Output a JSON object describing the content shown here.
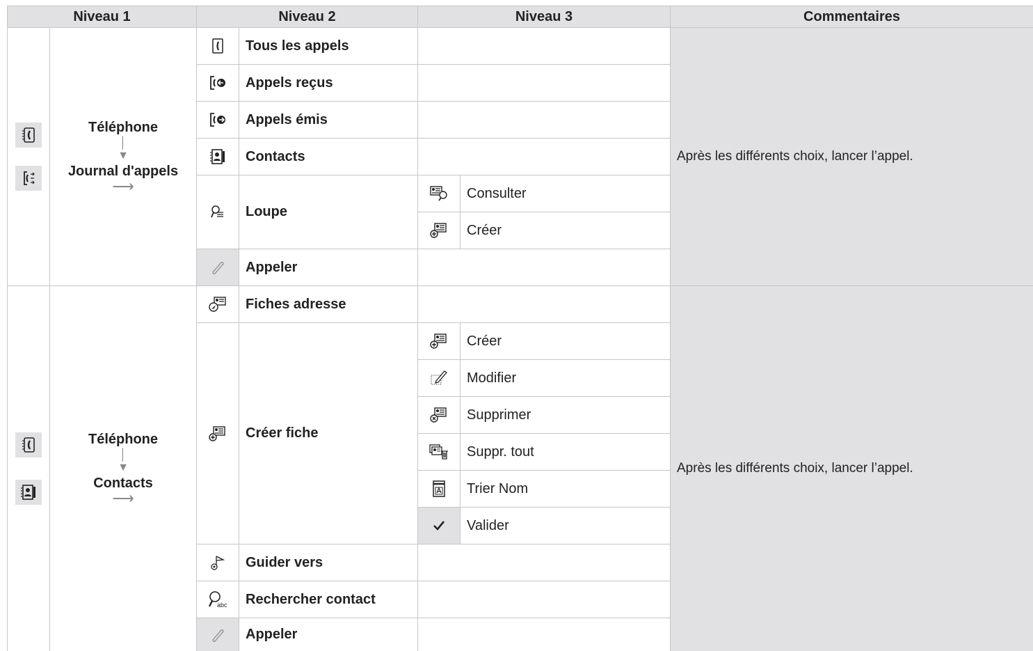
{
  "headers": {
    "level1": "Niveau 1",
    "level2": "Niveau 2",
    "level3": "Niveau 3",
    "comments": "Commentaires"
  },
  "section1": {
    "level1_line1": "Téléphone",
    "level1_line2": "Journal d'appels",
    "items": {
      "all_calls": "Tous les appels",
      "received": "Appels reçus",
      "dialled": "Appels émis",
      "contacts": "Contacts",
      "magnifier": "Loupe",
      "call": "Appeler"
    },
    "sub": {
      "consult": "Consulter",
      "create": "Créer"
    },
    "comment": "Après les différents choix, lancer l’appel."
  },
  "section2": {
    "level1_line1": "Téléphone",
    "level1_line2": "Contacts",
    "items": {
      "address_cards": "Fiches adresse",
      "create_card": "Créer fiche",
      "guide_to": "Guider vers",
      "search_contact": "Rechercher contact",
      "call": "Appeler"
    },
    "sub": {
      "create": "Créer",
      "modify": "Modifier",
      "delete": "Supprimer",
      "delete_all": "Suppr. tout",
      "sort_name": "Trier Nom",
      "validate": "Valider"
    },
    "comment": "Après les différents choix, lancer l’appel."
  },
  "colors": {
    "header_bg": "#e1e1e3",
    "border": "#c6c6c6"
  }
}
